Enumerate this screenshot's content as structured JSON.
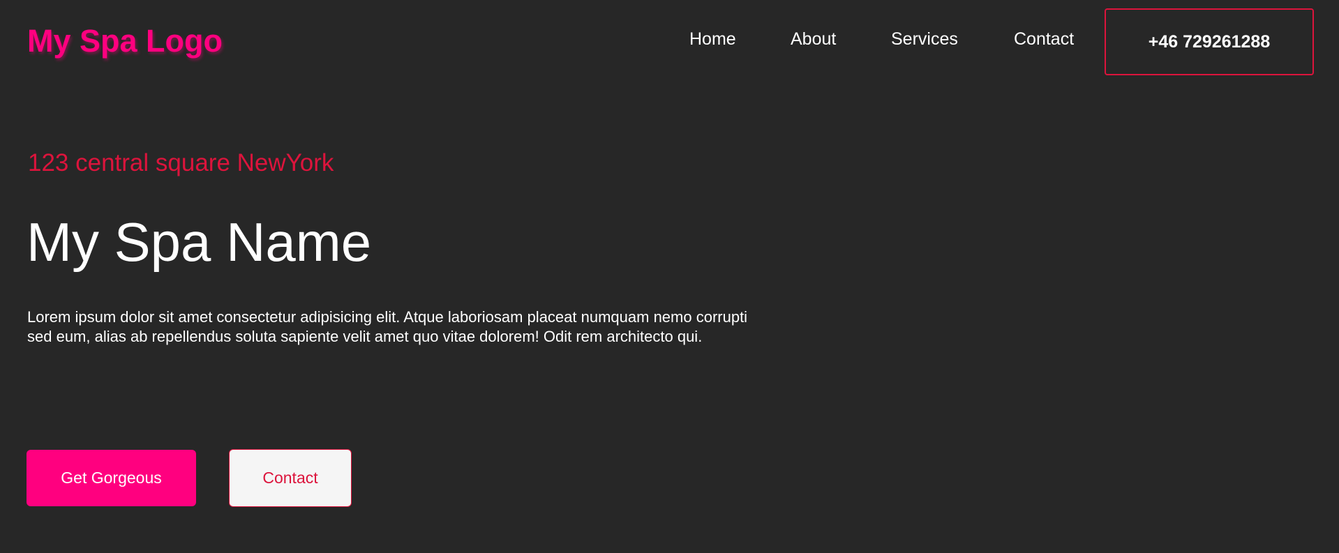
{
  "header": {
    "logo_text": "My Spa Logo",
    "nav": {
      "home": "Home",
      "about": "About",
      "services": "Services",
      "contact": "Contact"
    },
    "phone": "+46 729261288"
  },
  "hero": {
    "address": "123 central square NewYork",
    "title": "My Spa Name",
    "description": "Lorem ipsum dolor sit amet consectetur adipisicing elit. Atque laboriosam placeat numquam nemo corrupti sed eum, alias ab repellendus soluta sapiente velit amet quo vitae dolorem! Odit rem architecto qui.",
    "primary_button": "Get Gorgeous",
    "secondary_button": "Contact"
  },
  "colors": {
    "background": "#272727",
    "brand_pink": "#ff007f",
    "accent_crimson": "#dc143c",
    "text": "#ffffff"
  }
}
